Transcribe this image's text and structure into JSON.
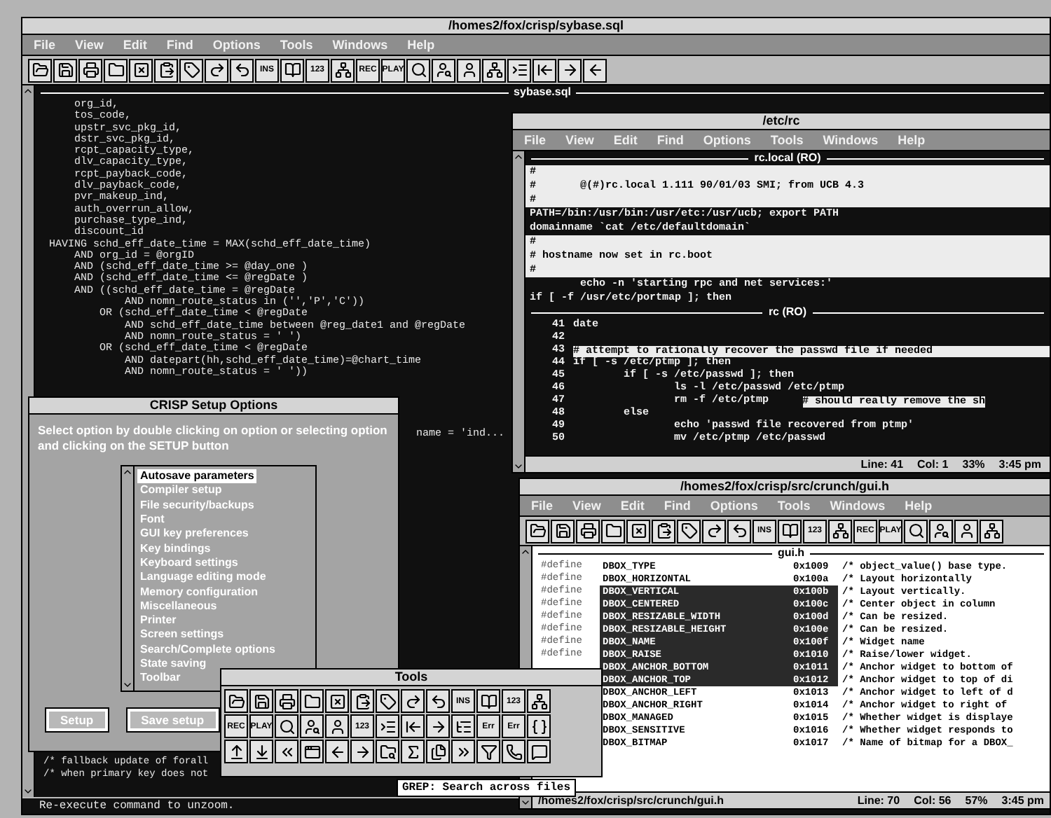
{
  "main_window": {
    "title": "/homes2/fox/crisp/sybase.sql",
    "menu": [
      "File",
      "View",
      "Edit",
      "Find",
      "Options",
      "Tools",
      "Windows",
      "Help"
    ],
    "toolbar_texts": [
      "INS",
      "123",
      "REC",
      "PLAY"
    ],
    "pane_title": "sybase.sql",
    "code_lines": [
      "    org_id,",
      "    tos_code,",
      "    upstr_svc_pkg_id,",
      "    dstr_svc_pkg_id,",
      "    rcpt_capacity_type,",
      "    dlv_capacity_type,",
      "    rcpt_payback_code,",
      "    dlv_payback_code,",
      "    pvr_makeup_ind,",
      "    auth_overrun_allow,",
      "    purchase_type_ind,",
      "    discount_id",
      "HAVING schd_eff_date_time = MAX(schd_eff_date_time)",
      "    AND org_id = @orgID",
      "    AND (schd_eff_date_time >= @day_one )",
      "    AND (schd_eff_date_time <= @regDate )",
      "    AND ((schd_eff_date_time = @regDate",
      "            AND nomn_route_status in ('','P','C'))",
      "        OR (schd_eff_date_time < @regDate",
      "            AND schd_eff_date_time between @reg_date1 and @regDate",
      "            AND nomn_route_status = ' ')",
      "        OR (schd_eff_date_time < @regDate",
      "            AND datepart(hh,schd_eff_date_time)=@chart_time",
      "            AND nomn_route_status = ' '))"
    ],
    "fragment": "name = 'ind...",
    "bottom_lines": [
      "/* fallback update of forall",
      "/* when primary key does not"
    ],
    "message": "Re-execute command to unzoom."
  },
  "rc_window": {
    "title": "/etc/rc",
    "menu": [
      "File",
      "View",
      "Edit",
      "Find",
      "Options",
      "Tools",
      "Windows",
      "Help"
    ],
    "local_pane": {
      "title": "rc.local (RO)",
      "lines": [
        {
          "kind": "comment",
          "text": "#"
        },
        {
          "kind": "comment",
          "text": "#       @(#)rc.local 1.111 90/01/03 SMI; from UCB 4.3"
        },
        {
          "kind": "comment",
          "text": "#"
        },
        {
          "kind": "code",
          "text": "PATH=/bin:/usr/bin:/usr/etc:/usr/ucb; export PATH"
        },
        {
          "kind": "code",
          "text": "domainname `cat /etc/defaultdomain`"
        },
        {
          "kind": "comment",
          "text": "#"
        },
        {
          "kind": "comment",
          "text": "# hostname now set in rc.boot"
        },
        {
          "kind": "comment",
          "text": "#"
        },
        {
          "kind": "code",
          "text": "        echo -n 'starting rpc and net services:'"
        },
        {
          "kind": "code",
          "text": "if [ -f /usr/etc/portmap ]; then"
        }
      ]
    },
    "rc_pane": {
      "title": "rc (RO)",
      "lines": [
        {
          "number": "41",
          "text": "date"
        },
        {
          "number": "42"
        },
        {
          "number": "43",
          "comment": "# attempt to rationally recover the passwd file if needed"
        },
        {
          "number": "44",
          "text": "if [ -s /etc/ptmp ]; then"
        },
        {
          "number": "45",
          "text": "        if [ -s /etc/passwd ]; then"
        },
        {
          "number": "46",
          "text": "                ls -l /etc/passwd /etc/ptmp"
        },
        {
          "number": "47",
          "text": "                rm -f /etc/ptmp",
          "comment": "# should really remove the sh"
        },
        {
          "number": "48",
          "text": "        else"
        },
        {
          "number": "49",
          "text": "                echo 'passwd file recovered from ptmp'"
        },
        {
          "number": "50",
          "text": "                mv /etc/ptmp /etc/passwd"
        }
      ]
    },
    "status": {
      "line": "Line: 41",
      "col": "Col: 1",
      "percent": "33%",
      "time": "3:45 pm"
    }
  },
  "gui_window": {
    "title": "/homes2/fox/crisp/src/crunch/gui.h",
    "menu": [
      "File",
      "View",
      "Edit",
      "Find",
      "Options",
      "Tools",
      "Windows",
      "Help"
    ],
    "toolbar_texts": [
      "INS",
      "123",
      "REC",
      "PLAY"
    ],
    "pane_title": "gui.h",
    "rows": [
      {
        "define": "#define",
        "name": "DBOX_TYPE",
        "value": "0x1009",
        "comment": "/* object_value() base type.",
        "selected": false
      },
      {
        "define": "#define",
        "name": "DBOX_HORIZONTAL",
        "value": "0x100a",
        "comment": "/* Layout horizontally",
        "selected": false
      },
      {
        "define": "#define",
        "name": "DBOX_VERTICAL",
        "value": "0x100b",
        "comment": "/* Layout vertically.",
        "selected": true
      },
      {
        "define": "#define",
        "name": "DBOX_CENTERED",
        "value": "0x100c",
        "comment": "/* Center object in column",
        "selected": true
      },
      {
        "define": "#define",
        "name": "DBOX_RESIZABLE_WIDTH",
        "value": "0x100d",
        "comment": "/* Can be resized.",
        "selected": true
      },
      {
        "define": "#define",
        "name": "DBOX_RESIZABLE_HEIGHT",
        "value": "0x100e",
        "comment": "/* Can be resized.",
        "selected": true
      },
      {
        "define": "#define",
        "name": "DBOX_NAME",
        "value": "0x100f",
        "comment": "/* Widget name",
        "selected": true
      },
      {
        "define": "#define",
        "name": "DBOX_RAISE",
        "value": "0x1010",
        "comment": "/* Raise/lower widget.",
        "selected": true
      },
      {
        "name": "DBOX_ANCHOR_BOTTOM",
        "value": "0x1011",
        "comment": "/* Anchor widget to bottom of",
        "selected": true
      },
      {
        "name": "DBOX_ANCHOR_TOP",
        "value": "0x1012",
        "comment": "/* Anchor widget to top of di",
        "selected": true
      },
      {
        "name": "DBOX_ANCHOR_LEFT",
        "value": "0x1013",
        "comment": "/* Anchor widget to left of d",
        "selected": false
      },
      {
        "name": "DBOX_ANCHOR_RIGHT",
        "value": "0x1014",
        "comment": "/* Anchor widget to right of",
        "selected": false
      },
      {
        "name": "DBOX_MANAGED",
        "value": "0x1015",
        "comment": "/* Whether widget is displaye",
        "selected": false
      },
      {
        "name": "DBOX_SENSITIVE",
        "value": "0x1016",
        "comment": "/* Whether widget responds to",
        "selected": false
      },
      {
        "name": "DBOX_BITMAP",
        "value": "0x1017",
        "comment": "/* Name of bitmap for a DBOX_",
        "selected": false
      }
    ],
    "status": {
      "path": "/homes2/fox/crisp/src/crunch/gui.h",
      "line": "Line: 70",
      "col": "Col: 56",
      "percent": "57%",
      "time": "3:45 pm"
    }
  },
  "setup_dialog": {
    "title": "CRISP Setup Options",
    "instructions": "Select option by double clicking on option or selecting option and clicking on the SETUP button",
    "options": [
      {
        "label": "Autosave parameters",
        "selected": true
      },
      {
        "label": "Compiler setup",
        "selected": false
      },
      {
        "label": "File security/backups",
        "selected": false
      },
      {
        "label": "Font",
        "selected": false
      },
      {
        "label": "GUI key preferences",
        "selected": false
      },
      {
        "label": "Key bindings",
        "selected": false
      },
      {
        "label": "Keyboard settings",
        "selected": false
      },
      {
        "label": "Language editing mode",
        "selected": false
      },
      {
        "label": "Memory configuration",
        "selected": false
      },
      {
        "label": "Miscellaneous",
        "selected": false
      },
      {
        "label": "Printer",
        "selected": false
      },
      {
        "label": "Screen settings",
        "selected": false
      },
      {
        "label": "Search/Complete options",
        "selected": false
      },
      {
        "label": "State saving",
        "selected": false
      },
      {
        "label": "Toolbar",
        "selected": false
      }
    ],
    "buttons": [
      "Setup",
      "Save setup"
    ]
  },
  "tools_palette": {
    "title": "Tools",
    "texts": [
      "INS",
      "123",
      "REC",
      "PLAY",
      "123",
      "Err",
      "Err"
    ],
    "tooltip": "GREP: Search across files"
  }
}
